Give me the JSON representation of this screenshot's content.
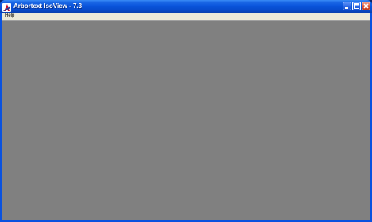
{
  "window": {
    "title": "Arbortext IsoView - 7.3",
    "app_icon": "arbortext-app-icon",
    "controls": {
      "minimize_icon": "minimize-icon",
      "maximize_icon": "maximize-icon",
      "close_icon": "close-icon"
    }
  },
  "menubar": {
    "items": [
      {
        "label": "Help"
      }
    ]
  },
  "workspace": {
    "background": "#808080"
  },
  "colors": {
    "titlebar": "#0a55dc",
    "frame": "#0a52df",
    "close_button": "#e05a3b",
    "menubar": "#ece9d8",
    "title_text": "#ffffff"
  }
}
